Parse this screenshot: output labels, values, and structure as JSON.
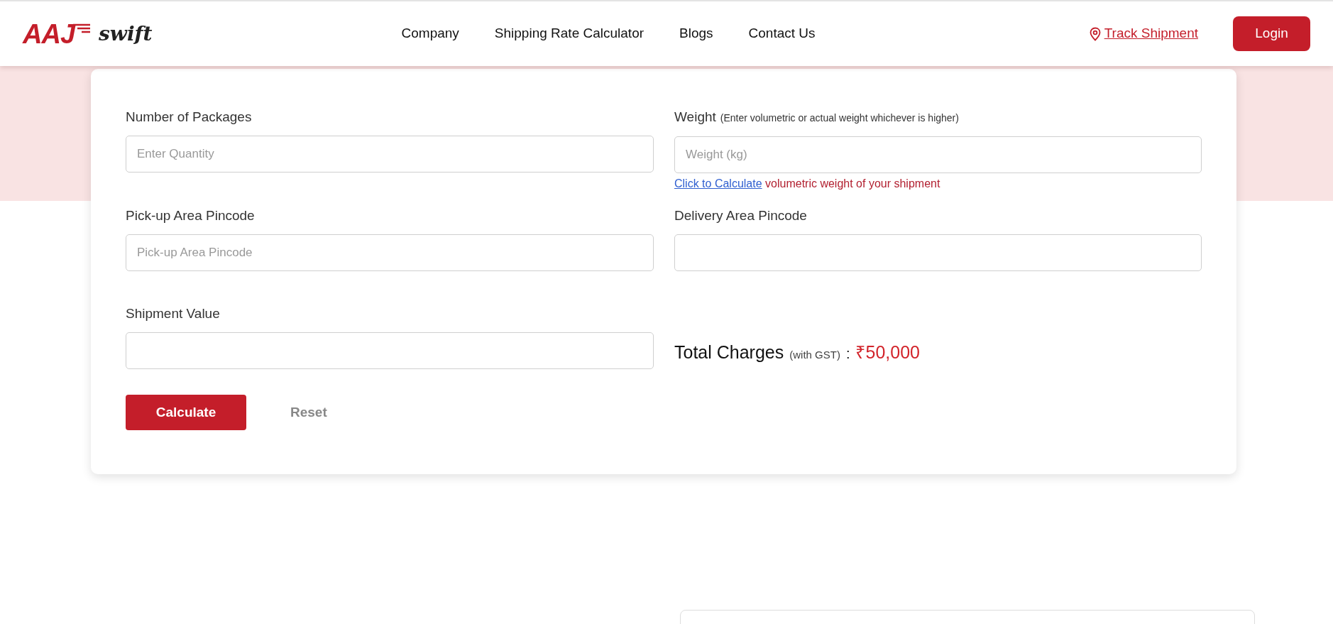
{
  "navbar": {
    "logo": {
      "mark": "AAJ",
      "word": "swift"
    },
    "links": [
      {
        "label": "Company"
      },
      {
        "label": "Shipping Rate Calculator"
      },
      {
        "label": "Blogs"
      },
      {
        "label": "Contact Us"
      }
    ],
    "track_link": "Track Shipment",
    "login_button": "Login"
  },
  "calculator": {
    "fields": [
      {
        "label": "Number of Packages",
        "placeholder": "Enter Quantity"
      },
      {
        "label": "Weight",
        "note": "(Enter volumetric or actual weight whichever is higher)",
        "placeholder": "Weight (kg)",
        "help_link": "Click to Calculate",
        "help_text": "volumetric weight of your shipment"
      },
      {
        "label": "Pick-up Area Pincode",
        "placeholder": "Pick-up Area Pincode"
      },
      {
        "label": "Delivery Area Pincode"
      },
      {
        "label": "Shipment Value"
      }
    ],
    "total": {
      "label": "Total Charges",
      "note": "(with GST)",
      "separator": ":",
      "amount": "₹50,000"
    },
    "buttons": [
      {
        "label": "Calculate",
        "kind": "primary"
      },
      {
        "label": "Reset",
        "kind": "plain"
      }
    ]
  }
}
